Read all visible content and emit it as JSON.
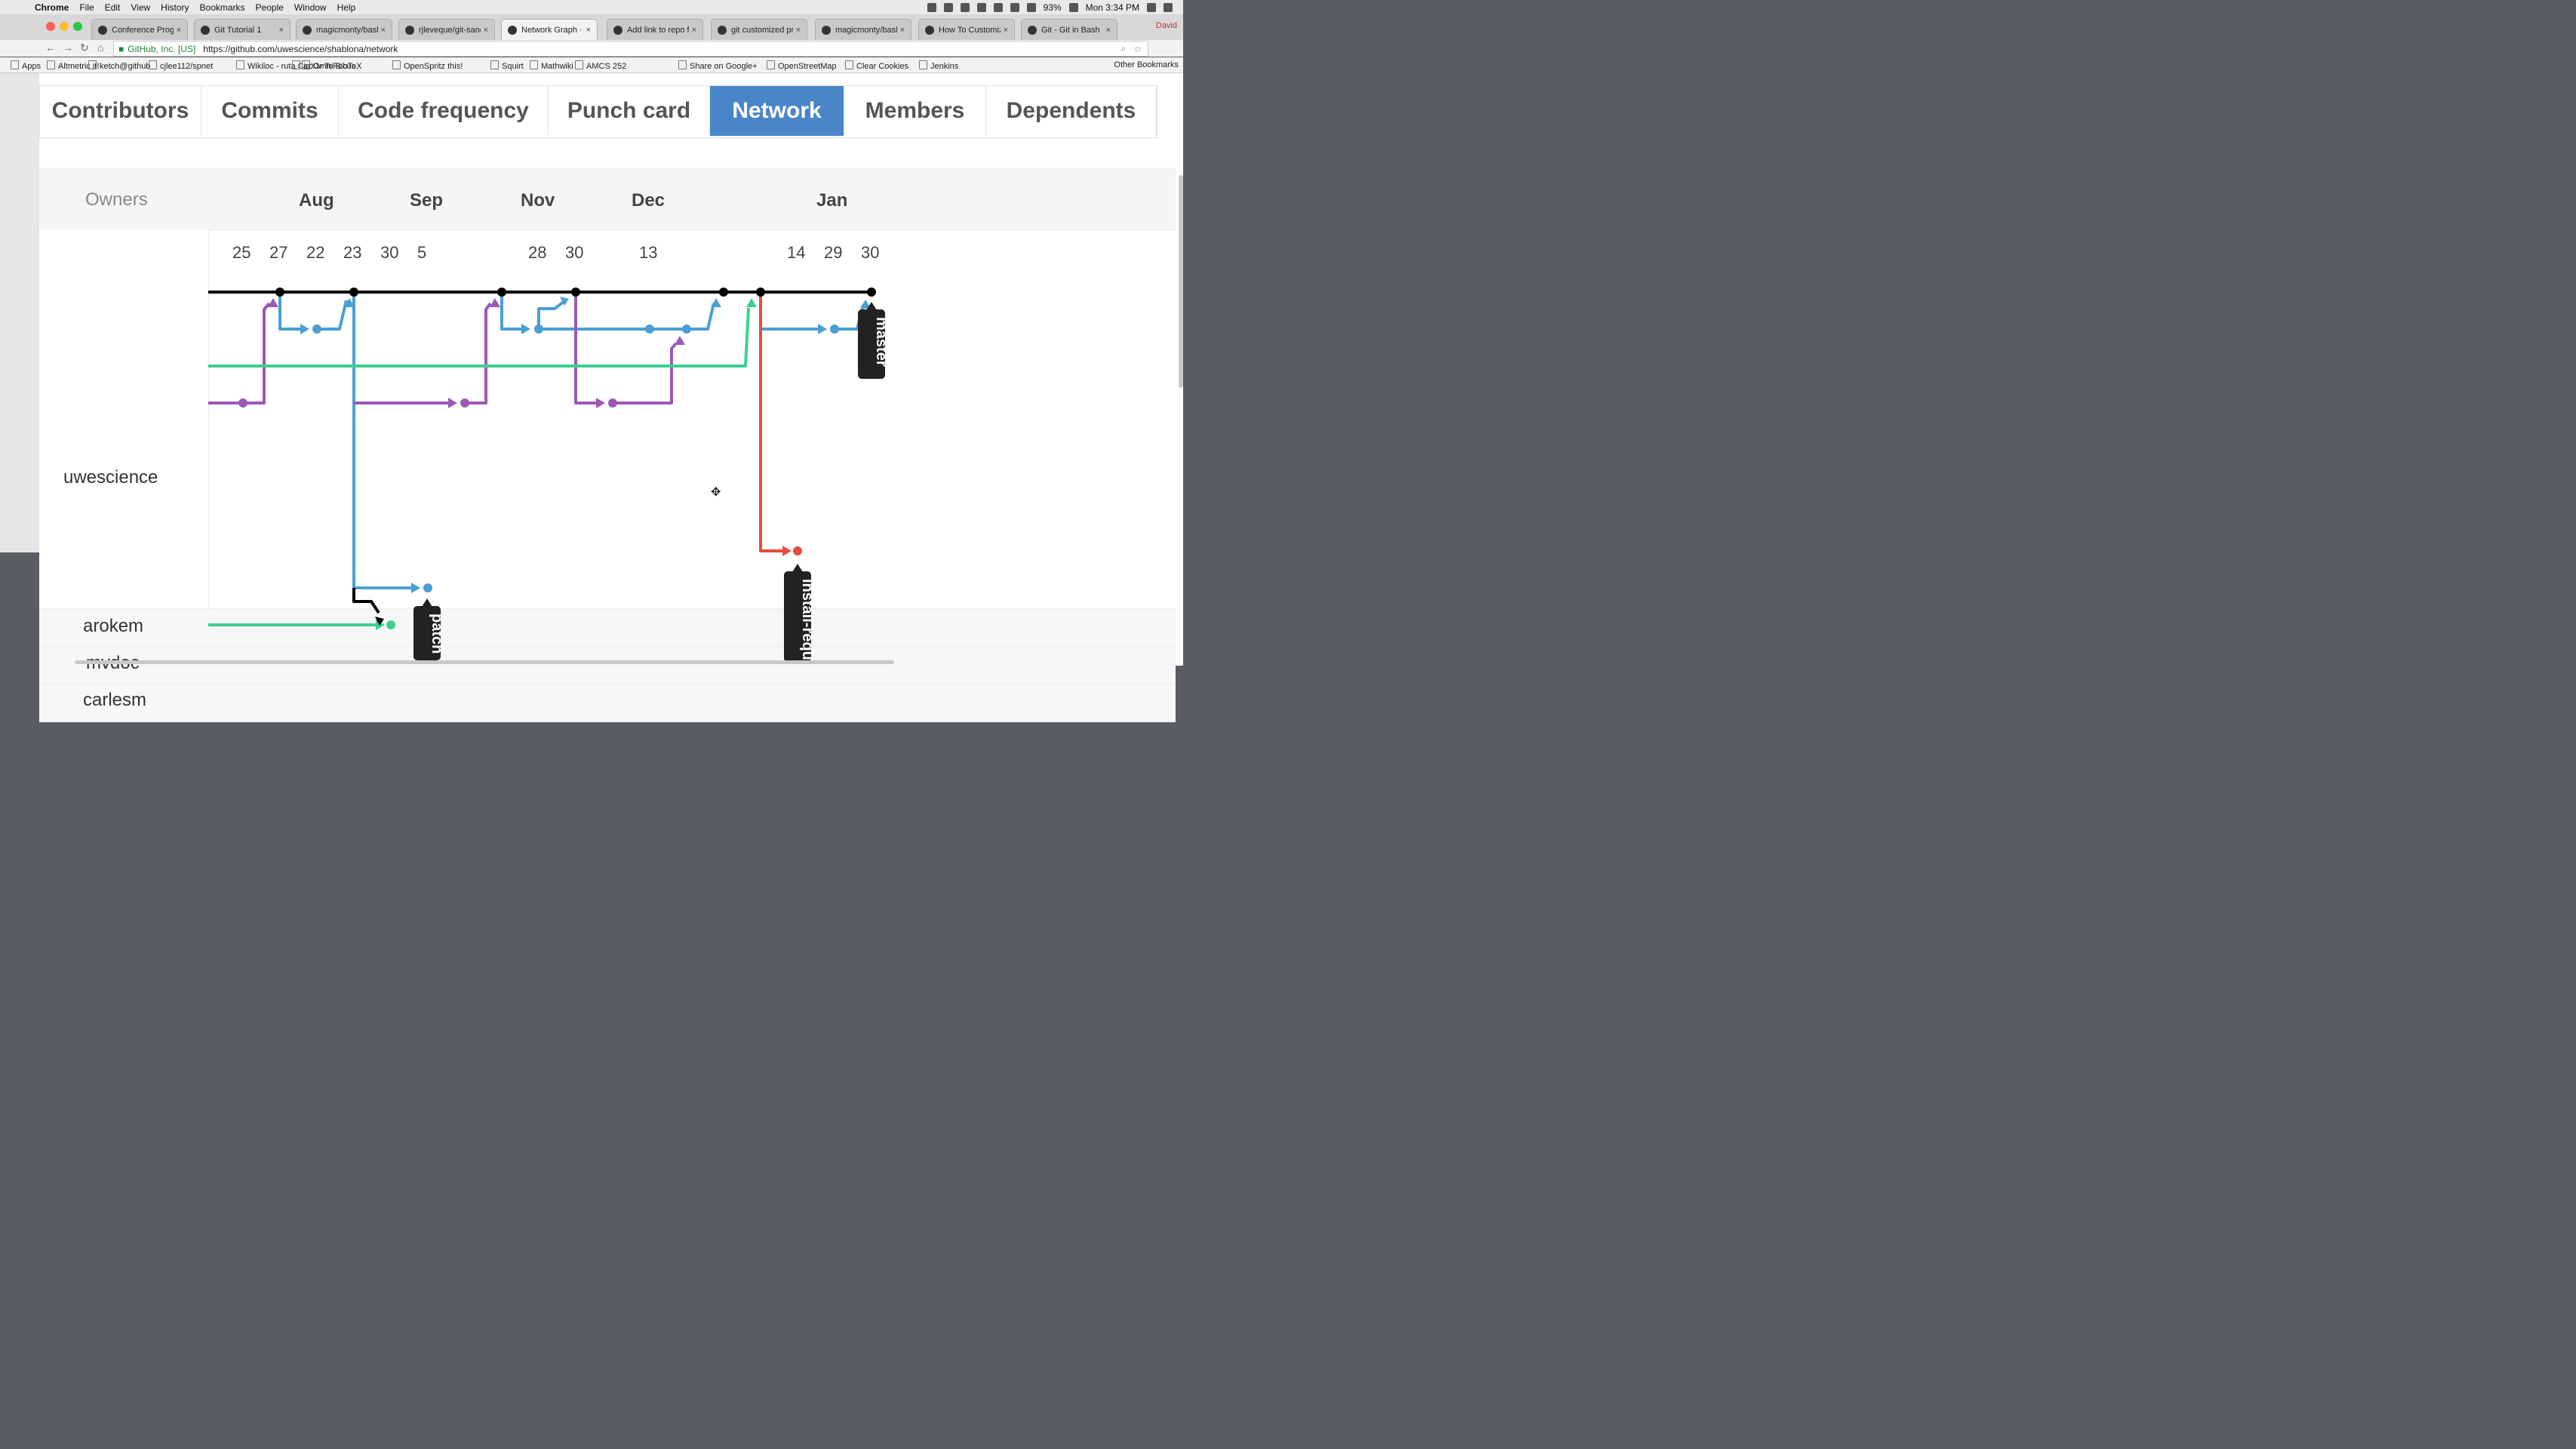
{
  "os": {
    "menus": [
      "Chrome",
      "File",
      "Edit",
      "View",
      "History",
      "Bookmarks",
      "People",
      "Window",
      "Help"
    ],
    "battery": "93%",
    "clock": "Mon 3:34 PM"
  },
  "browser": {
    "tabs": [
      {
        "title": "Conference Progra",
        "active": false
      },
      {
        "title": "Git Tutorial 1",
        "active": false
      },
      {
        "title": "magicmonty/bash",
        "active": false
      },
      {
        "title": "rjleveque/git-sand",
        "active": false
      },
      {
        "title": "Network Graph · u",
        "active": true
      },
      {
        "title": "Add link to repo fo",
        "active": false
      },
      {
        "title": "git customized pro",
        "active": false
      },
      {
        "title": "magicmonty/bash",
        "active": false
      },
      {
        "title": "How To Customiz",
        "active": false
      },
      {
        "title": "Git - Git in Bash",
        "active": false
      }
    ],
    "profile": "David",
    "secure_label": "GitHub, Inc. [US]",
    "url": "https://github.com/uwescience/shablona/network",
    "bookmarks": [
      "Apps",
      "Altmetric it!",
      "ketch@github",
      "cjlee112/spnet",
      "Wikiloc - ruta Circ...",
      "arXiv To BibTeX",
      "OmniFocus",
      "OpenSpritz this!",
      "Squirt",
      "Mathwiki",
      "AMCS 252",
      "Share on Google+",
      "OpenStreetMap",
      "Clear Cookies",
      "Jenkins"
    ],
    "other_bookmarks": "Other Bookmarks"
  },
  "insights_tabs": [
    "Contributors",
    "Commits",
    "Code frequency",
    "Punch card",
    "Network",
    "Members",
    "Dependents"
  ],
  "network": {
    "owners_label": "Owners",
    "months": [
      "Aug",
      "Sep",
      "Nov",
      "Dec",
      "Jan"
    ],
    "days": [
      "25",
      "27",
      "22",
      "23",
      "30",
      "5",
      "28",
      "30",
      "13",
      "14",
      "29",
      "30"
    ],
    "owners": [
      "uwescience",
      "arokem",
      "mvdoc",
      "carlesm"
    ],
    "branch_labels": [
      "master",
      "install-requ",
      "patch"
    ],
    "colors": {
      "master": "#000000",
      "blue": "#4a9fd4",
      "purple": "#9b59b6",
      "green": "#3ecf8e",
      "red": "#e74c3c"
    }
  }
}
